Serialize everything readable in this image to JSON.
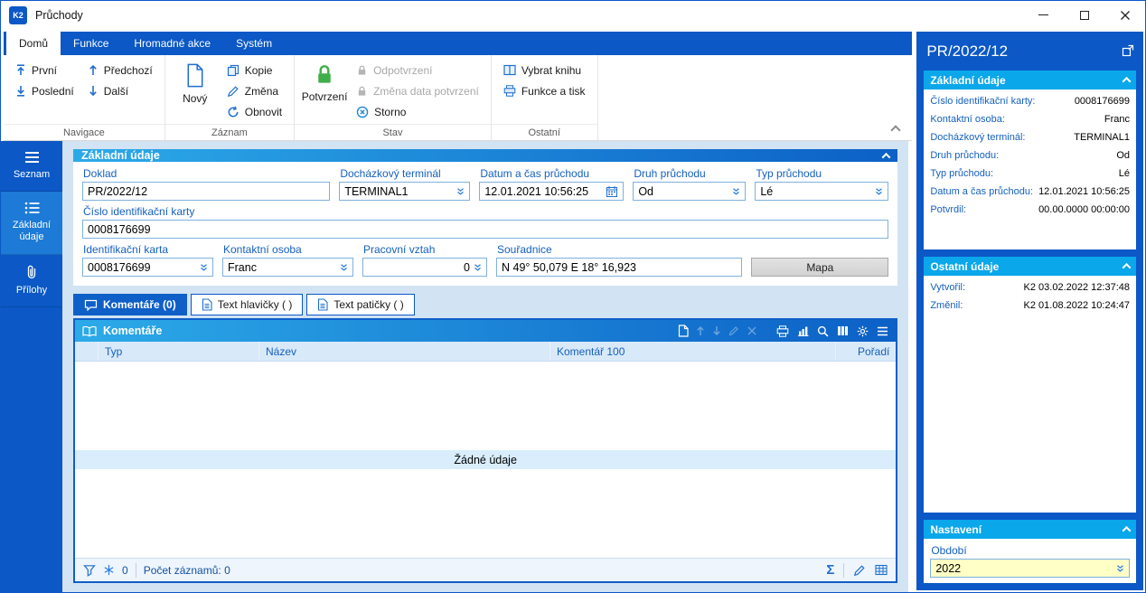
{
  "window": {
    "title": "Průchody",
    "logo": "K2"
  },
  "ribbon": {
    "tabs": [
      {
        "label": "Domů"
      },
      {
        "label": "Funkce"
      },
      {
        "label": "Hromadné akce"
      },
      {
        "label": "Systém"
      }
    ],
    "navigace": {
      "label": "Navigace",
      "prvni": "První",
      "posledni": "Poslední",
      "predchozi": "Předchozí",
      "dalsi": "Další"
    },
    "zaznam": {
      "label": "Záznam",
      "novy": "Nový",
      "kopie": "Kopie",
      "zmena": "Změna",
      "obnovit": "Obnovit"
    },
    "stav": {
      "label": "Stav",
      "potvrzeni": "Potvrzení",
      "odpotvrzeni": "Odpotvrzení",
      "zmena_data": "Změna data potvrzení",
      "storno": "Storno"
    },
    "ostatni": {
      "label": "Ostatní",
      "vybrat_knihu": "Vybrat knihu",
      "funkce_a_tisk": "Funkce a tisk"
    }
  },
  "sidebar": {
    "seznam": "Seznam",
    "zakladni_udaje": "Základní údaje",
    "prilohy": "Přílohy"
  },
  "form": {
    "section_title": "Základní údaje",
    "doklad_label": "Doklad",
    "doklad_value": "PR/2022/12",
    "terminal_label": "Docházkový terminál",
    "terminal_value": "TERMINAL1",
    "datum_label": "Datum a čas průchodu",
    "datum_value": "12.01.2021 10:56:25",
    "druh_label": "Druh průchodu",
    "druh_value": "Od",
    "typ_label": "Typ průchodu",
    "typ_value": "Lé",
    "cislo_karty_label": "Číslo identifikační karty",
    "cislo_karty_value": "0008176699",
    "id_karta_label": "Identifikační karta",
    "id_karta_value": "0008176699",
    "osoba_label": "Kontaktní osoba",
    "osoba_value": "Franc",
    "vztah_label": "Pracovní vztah",
    "vztah_value": "0",
    "souradnice_label": "Souřadnice",
    "souradnice_value": "N 49° 50,079 E 18° 16,923",
    "mapa": "Mapa"
  },
  "detail_tabs": [
    {
      "label": "Komentáře (0)"
    },
    {
      "label": "Text hlavičky ( )"
    },
    {
      "label": "Text patičky ( )"
    }
  ],
  "grid": {
    "title": "Komentáře",
    "col_typ": "Typ",
    "col_nazev": "Název",
    "col_komentar": "Komentář 100",
    "col_poradi": "Pořadí",
    "empty": "Žádné údaje",
    "filter_value": "0",
    "records": "Počet záznamů: 0"
  },
  "preview": {
    "title": "PR/2022/12",
    "sections": [
      {
        "title": "Základní údaje",
        "rows": [
          {
            "label": "Číslo identifikační karty:",
            "value": "0008176699"
          },
          {
            "label": "Kontaktní osoba:",
            "value": "Franc"
          },
          {
            "label": "Docházkový terminál:",
            "value": "TERMINAL1"
          },
          {
            "label": "Druh průchodu:",
            "value": "Od"
          },
          {
            "label": "Typ průchodu:",
            "value": "Lé"
          },
          {
            "label": "Datum a čas průchodu:",
            "value": "12.01.2021 10:56:25"
          },
          {
            "label": "Potvrdil:",
            "value": "00.00.0000 00:00:00"
          }
        ]
      },
      {
        "title": "Ostatní údaje",
        "rows": [
          {
            "label": "Vytvořil:",
            "value": "K2 03.02.2022 12:37:48"
          },
          {
            "label": "Změnil:",
            "value": "K2 01.08.2022 10:24:47"
          }
        ]
      },
      {
        "title": "Nastavení"
      }
    ],
    "obdobi_label": "Období",
    "obdobi_value": "2022"
  },
  "icons": {
    "sum": "Σ"
  },
  "colors": {
    "accent_blue": "#0b58c6",
    "header_gradient_start": "#2caae8",
    "header_gradient_end": "#0c60c6",
    "card_header_cyan": "#0aa7ea",
    "label_blue": "#1560bd",
    "lock_green": "#3fae49",
    "field_yellow": "#ffffc6"
  }
}
